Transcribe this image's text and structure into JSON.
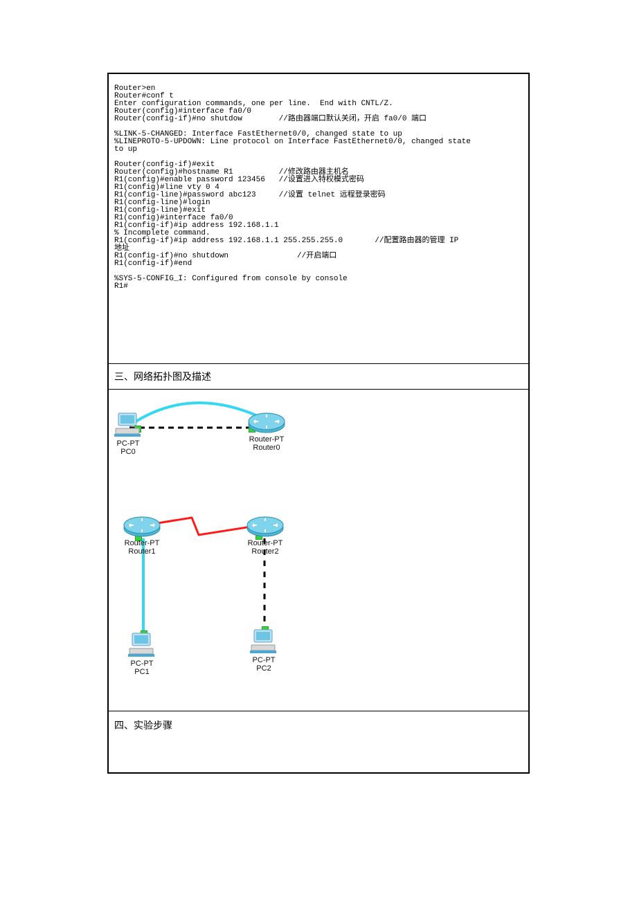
{
  "cli": {
    "lines": "Router>en\nRouter#conf t\nEnter configuration commands, one per line.  End with CNTL/Z.\nRouter(config)#interface fa0/0\nRouter(config-if)#no shutdow        //路由器端口默认关闭，开启 fa0/0 端口\n\n%LINK-5-CHANGED: Interface FastEthernet0/0, changed state to up\n%LINEPROTO-5-UPDOWN: Line protocol on Interface FastEthernet0/0, changed state\nto up\n\nRouter(config-if)#exit\nRouter(config)#hostname R1          //修改路由器主机名\nR1(config)#enable password 123456   //设置进入特权模式密码\nR1(config)#line vty 0 4\nR1(config-line)#password abc123     //设置 telnet 远程登录密码\nR1(config-line)#login\nR1(config-line)#exit\nR1(config)#interface fa0/0\nR1(config-if)#ip address 192.168.1.1\n% Incomplete command.\nR1(config-if)#ip address 192.168.1.1 255.255.255.0       //配置路由器的管理 IP\n地址\nR1(config-if)#no shutdown               //开启端口\nR1(config-if)#end\n\n%SYS-5-CONFIG_I: Configured from console by console\nR1#"
  },
  "section3": {
    "title": "三、网络拓扑图及描述"
  },
  "section4": {
    "title": "四、实验步骤"
  },
  "topology": {
    "pc0": {
      "type": "PC-PT",
      "host": "PC0"
    },
    "pc1": {
      "type": "PC-PT",
      "host": "PC1"
    },
    "pc2": {
      "type": "PC-PT",
      "host": "PC2"
    },
    "router0": {
      "type": "Router-PT",
      "host": "Router0"
    },
    "router1": {
      "type": "Router-PT",
      "host": "Router1"
    },
    "router2": {
      "type": "Router-PT",
      "host": "Router2"
    }
  }
}
